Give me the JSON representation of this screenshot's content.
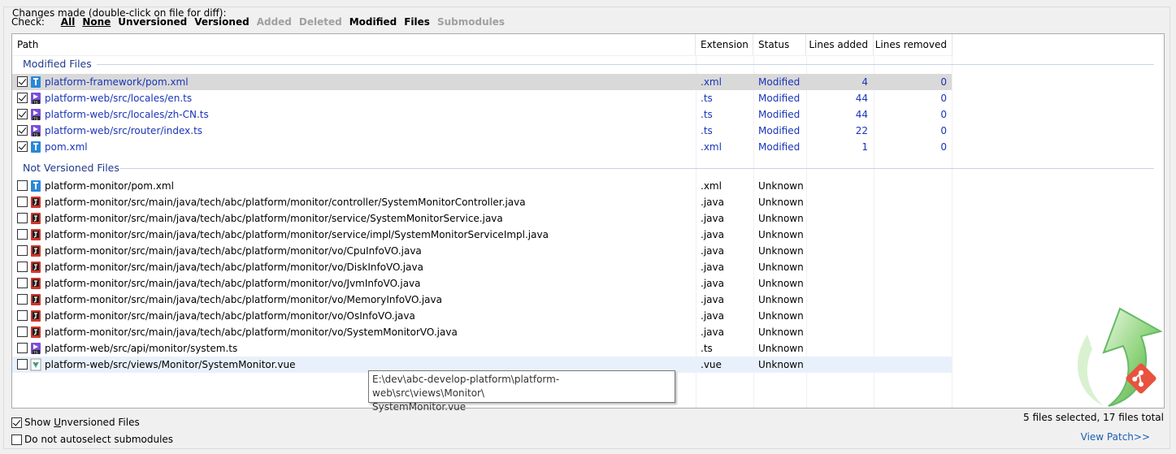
{
  "group_title": "Changes made (double-click on file for diff):",
  "check_bar": {
    "label": "Check:",
    "links": [
      {
        "text": "All",
        "state": "enabled",
        "underline": true
      },
      {
        "text": "None",
        "state": "enabled",
        "underline": true
      },
      {
        "text": "Unversioned",
        "state": "enabled",
        "underline": false
      },
      {
        "text": "Versioned",
        "state": "enabled",
        "underline": false
      },
      {
        "text": "Added",
        "state": "disabled",
        "underline": false
      },
      {
        "text": "Deleted",
        "state": "disabled",
        "underline": false
      },
      {
        "text": "Modified",
        "state": "enabled",
        "underline": false
      },
      {
        "text": "Files",
        "state": "enabled",
        "underline": false
      },
      {
        "text": "Submodules",
        "state": "disabled",
        "underline": false
      }
    ]
  },
  "columns": [
    "Path",
    "Extension",
    "Status",
    "Lines added",
    "Lines removed"
  ],
  "groups": [
    {
      "title": "Modified Files",
      "rows": [
        {
          "checked": true,
          "icon": "xml-file-icon",
          "path": "platform-framework/pom.xml",
          "ext": ".xml",
          "status": "Modified",
          "added": "4",
          "removed": "0",
          "selected": true
        },
        {
          "checked": true,
          "icon": "ts-file-icon",
          "path": "platform-web/src/locales/en.ts",
          "ext": ".ts",
          "status": "Modified",
          "added": "44",
          "removed": "0"
        },
        {
          "checked": true,
          "icon": "ts-file-icon",
          "path": "platform-web/src/locales/zh-CN.ts",
          "ext": ".ts",
          "status": "Modified",
          "added": "44",
          "removed": "0"
        },
        {
          "checked": true,
          "icon": "ts-file-icon",
          "path": "platform-web/src/router/index.ts",
          "ext": ".ts",
          "status": "Modified",
          "added": "22",
          "removed": "0"
        },
        {
          "checked": true,
          "icon": "xml-file-icon",
          "path": "pom.xml",
          "ext": ".xml",
          "status": "Modified",
          "added": "1",
          "removed": "0"
        }
      ]
    },
    {
      "title": "Not Versioned Files",
      "rows": [
        {
          "checked": false,
          "icon": "xml-file-icon",
          "path": "platform-monitor/pom.xml",
          "ext": ".xml",
          "status": "Unknown",
          "added": "",
          "removed": ""
        },
        {
          "checked": false,
          "icon": "java-file-icon",
          "path": "platform-monitor/src/main/java/tech/abc/platform/monitor/controller/SystemMonitorController.java",
          "ext": ".java",
          "status": "Unknown",
          "added": "",
          "removed": ""
        },
        {
          "checked": false,
          "icon": "java-file-icon",
          "path": "platform-monitor/src/main/java/tech/abc/platform/monitor/service/SystemMonitorService.java",
          "ext": ".java",
          "status": "Unknown",
          "added": "",
          "removed": ""
        },
        {
          "checked": false,
          "icon": "java-file-icon",
          "path": "platform-monitor/src/main/java/tech/abc/platform/monitor/service/impl/SystemMonitorServiceImpl.java",
          "ext": ".java",
          "status": "Unknown",
          "added": "",
          "removed": ""
        },
        {
          "checked": false,
          "icon": "java-file-icon",
          "path": "platform-monitor/src/main/java/tech/abc/platform/monitor/vo/CpuInfoVO.java",
          "ext": ".java",
          "status": "Unknown",
          "added": "",
          "removed": ""
        },
        {
          "checked": false,
          "icon": "java-file-icon",
          "path": "platform-monitor/src/main/java/tech/abc/platform/monitor/vo/DiskInfoVO.java",
          "ext": ".java",
          "status": "Unknown",
          "added": "",
          "removed": ""
        },
        {
          "checked": false,
          "icon": "java-file-icon",
          "path": "platform-monitor/src/main/java/tech/abc/platform/monitor/vo/JvmInfoVO.java",
          "ext": ".java",
          "status": "Unknown",
          "added": "",
          "removed": ""
        },
        {
          "checked": false,
          "icon": "java-file-icon",
          "path": "platform-monitor/src/main/java/tech/abc/platform/monitor/vo/MemoryInfoVO.java",
          "ext": ".java",
          "status": "Unknown",
          "added": "",
          "removed": ""
        },
        {
          "checked": false,
          "icon": "java-file-icon",
          "path": "platform-monitor/src/main/java/tech/abc/platform/monitor/vo/OsInfoVO.java",
          "ext": ".java",
          "status": "Unknown",
          "added": "",
          "removed": ""
        },
        {
          "checked": false,
          "icon": "java-file-icon",
          "path": "platform-monitor/src/main/java/tech/abc/platform/monitor/vo/SystemMonitorVO.java",
          "ext": ".java",
          "status": "Unknown",
          "added": "",
          "removed": ""
        },
        {
          "checked": false,
          "icon": "ts-file-icon",
          "path": "platform-web/src/api/monitor/system.ts",
          "ext": ".ts",
          "status": "Unknown",
          "added": "",
          "removed": ""
        },
        {
          "checked": false,
          "icon": "vue-file-icon",
          "path": "platform-web/src/views/Monitor/SystemMonitor.vue",
          "ext": ".vue",
          "status": "Unknown",
          "added": "",
          "removed": "",
          "hover": true
        }
      ]
    }
  ],
  "tooltip": {
    "line1": "E:\\dev\\abc-develop-platform\\platform-web\\src\\views\\Monitor\\",
    "line2": "SystemMonitor.vue"
  },
  "options": {
    "show_unversioned": {
      "label": "Show Unversioned Files",
      "underline_char": "U",
      "checked": true
    },
    "no_autoselect": {
      "label": "Do not autoselect submodules",
      "checked": false
    }
  },
  "status_text": "5 files selected, 17 files total",
  "view_patch": "View Patch>>",
  "colors": {
    "modified_text": "#1a35b8",
    "group_header": "#1e3a8c",
    "link": "#1a5fb4",
    "arrow": "#4caf50"
  }
}
